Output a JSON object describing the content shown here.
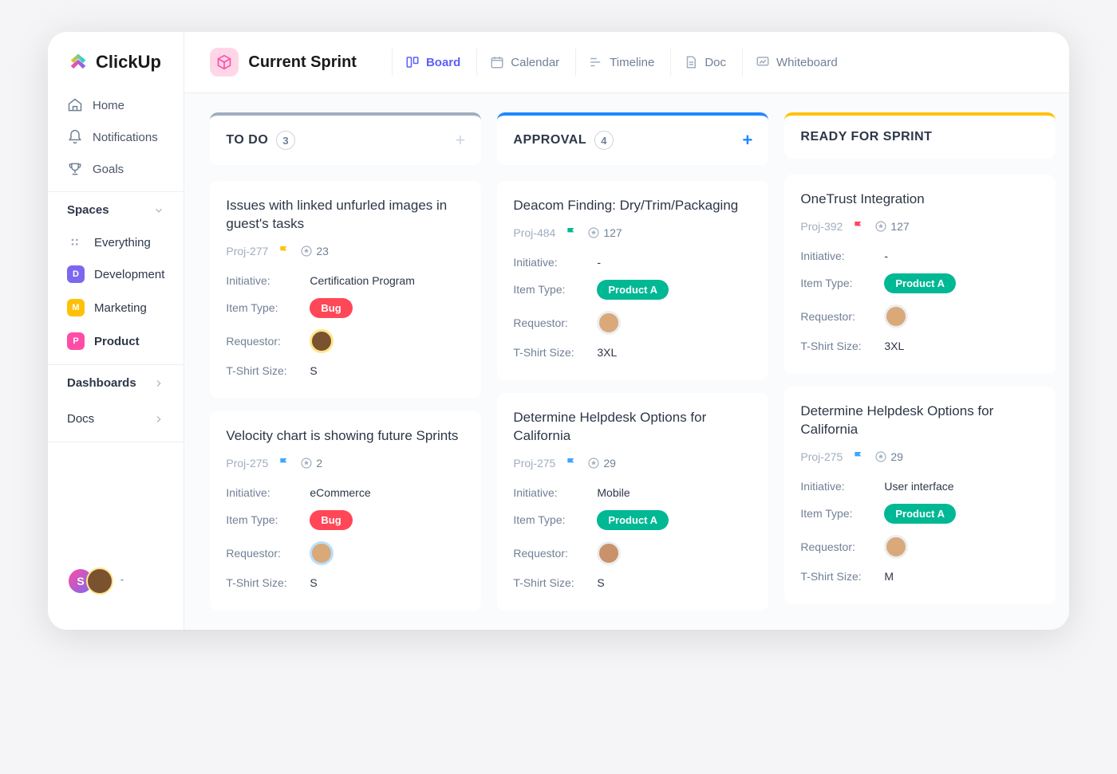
{
  "brand": "ClickUp",
  "nav": {
    "home": "Home",
    "notifications": "Notifications",
    "goals": "Goals"
  },
  "spaces_header": "Spaces",
  "spaces": {
    "everything": "Everything",
    "development": {
      "letter": "D",
      "label": "Development"
    },
    "marketing": {
      "letter": "M",
      "label": "Marketing"
    },
    "product": {
      "letter": "P",
      "label": "Product"
    }
  },
  "dashboards": "Dashboards",
  "docs_nav": "Docs",
  "footer_avatar": "S",
  "sprint_title": "Current Sprint",
  "views": {
    "board": "Board",
    "calendar": "Calendar",
    "timeline": "Timeline",
    "doc": "Doc",
    "whiteboard": "Whiteboard"
  },
  "columns": [
    {
      "title": "TO DO",
      "count": "3",
      "cards": [
        {
          "title": "Issues with linked unfurled images in guest's tasks",
          "id": "Proj-277",
          "flag": "#ffc107",
          "score": "23",
          "initiative": "Certification Program",
          "type": "Bug",
          "type_class": "red",
          "req_border": "#ffe58a",
          "req_bg": "#7a5230",
          "size": "S"
        },
        {
          "title": "Velocity chart is showing future Sprints",
          "id": "Proj-275",
          "flag": "#3ea6ff",
          "score": "2",
          "initiative": "eCommerce",
          "type": "Bug",
          "type_class": "red",
          "req_border": "#b8e0ff",
          "req_bg": "#d9a97a",
          "size": "S"
        }
      ]
    },
    {
      "title": "APPROVAL",
      "count": "4",
      "cards": [
        {
          "title": "Deacom Finding: Dry/Trim/Packaging",
          "id": "Proj-484",
          "flag": "#00b894",
          "score": "127",
          "initiative": "-",
          "type": "Product A",
          "type_class": "green",
          "req_border": "#eceef0",
          "req_bg": "#d9a97a",
          "size": "3XL"
        },
        {
          "title": "Determine Helpdesk Options for California",
          "id": "Proj-275",
          "flag": "#3ea6ff",
          "score": "29",
          "initiative": "Mobile",
          "type": "Product A",
          "type_class": "green",
          "req_border": "#eceef0",
          "req_bg": "#c9926a",
          "size": "S"
        }
      ]
    },
    {
      "title": "READY FOR SPRINT",
      "count": "",
      "cards": [
        {
          "title": "OneTrust Integration",
          "id": "Proj-392",
          "flag": "#ff4757",
          "score": "127",
          "initiative": "-",
          "type": "Product A",
          "type_class": "green",
          "req_border": "#eceef0",
          "req_bg": "#d9a97a",
          "size": "3XL"
        },
        {
          "title": "Determine Helpdesk Options for California",
          "id": "Proj-275",
          "flag": "#3ea6ff",
          "score": "29",
          "initiative": "User interface",
          "type": "Product A",
          "type_class": "green",
          "req_border": "#eceef0",
          "req_bg": "#d9a97a",
          "size": "M"
        }
      ]
    }
  ],
  "labels": {
    "initiative": "Initiative:",
    "item_type": "Item Type:",
    "requestor": "Requestor:",
    "size": "T-Shirt Size:"
  }
}
